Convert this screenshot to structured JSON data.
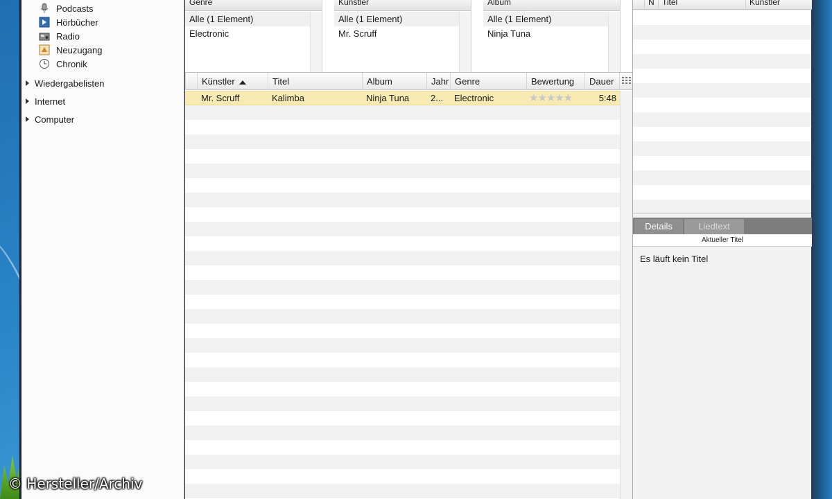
{
  "sidebar": {
    "items": [
      {
        "label": "Podcasts",
        "icon": "microphone-icon"
      },
      {
        "label": "Hörbücher",
        "icon": "audiobook-icon"
      },
      {
        "label": "Radio",
        "icon": "radio-icon"
      },
      {
        "label": "Neuzugang",
        "icon": "new-arrivals-icon"
      },
      {
        "label": "Chronik",
        "icon": "clock-icon"
      }
    ],
    "groups": [
      {
        "label": "Wiedergabelisten"
      },
      {
        "label": "Internet"
      },
      {
        "label": "Computer"
      }
    ]
  },
  "browser": {
    "panes": [
      {
        "header": "Genre",
        "rows": [
          "Alle  (1 Element)",
          "Electronic"
        ]
      },
      {
        "header": "Künstler",
        "rows": [
          "Alle  (1 Element)",
          "Mr. Scruff"
        ]
      },
      {
        "header": "Album",
        "rows": [
          "Alle  (1 Element)",
          "Ninja Tuna"
        ]
      }
    ]
  },
  "tracklist": {
    "columns": [
      "Künstler",
      "Titel",
      "Album",
      "Jahr",
      "Genre",
      "Bewertung",
      "Dauer"
    ],
    "rows": [
      {
        "artist": "Mr. Scruff",
        "title": "Kalimba",
        "album": "Ninja Tuna",
        "year": "2...",
        "genre": "Electronic",
        "rating": "★★★★★",
        "duration": "5:48"
      }
    ]
  },
  "right_panel": {
    "columns": [
      "N",
      "Titel",
      "Künstler"
    ],
    "tabs": [
      "Details",
      "Liedtext"
    ],
    "subheader": "Aktueller Titel",
    "now_playing": "Es läuft kein Titel"
  },
  "watermark": "© Hersteller/Archiv",
  "colors": {
    "selected_row": "#f7eab3",
    "desktop": "#2a84c8"
  }
}
